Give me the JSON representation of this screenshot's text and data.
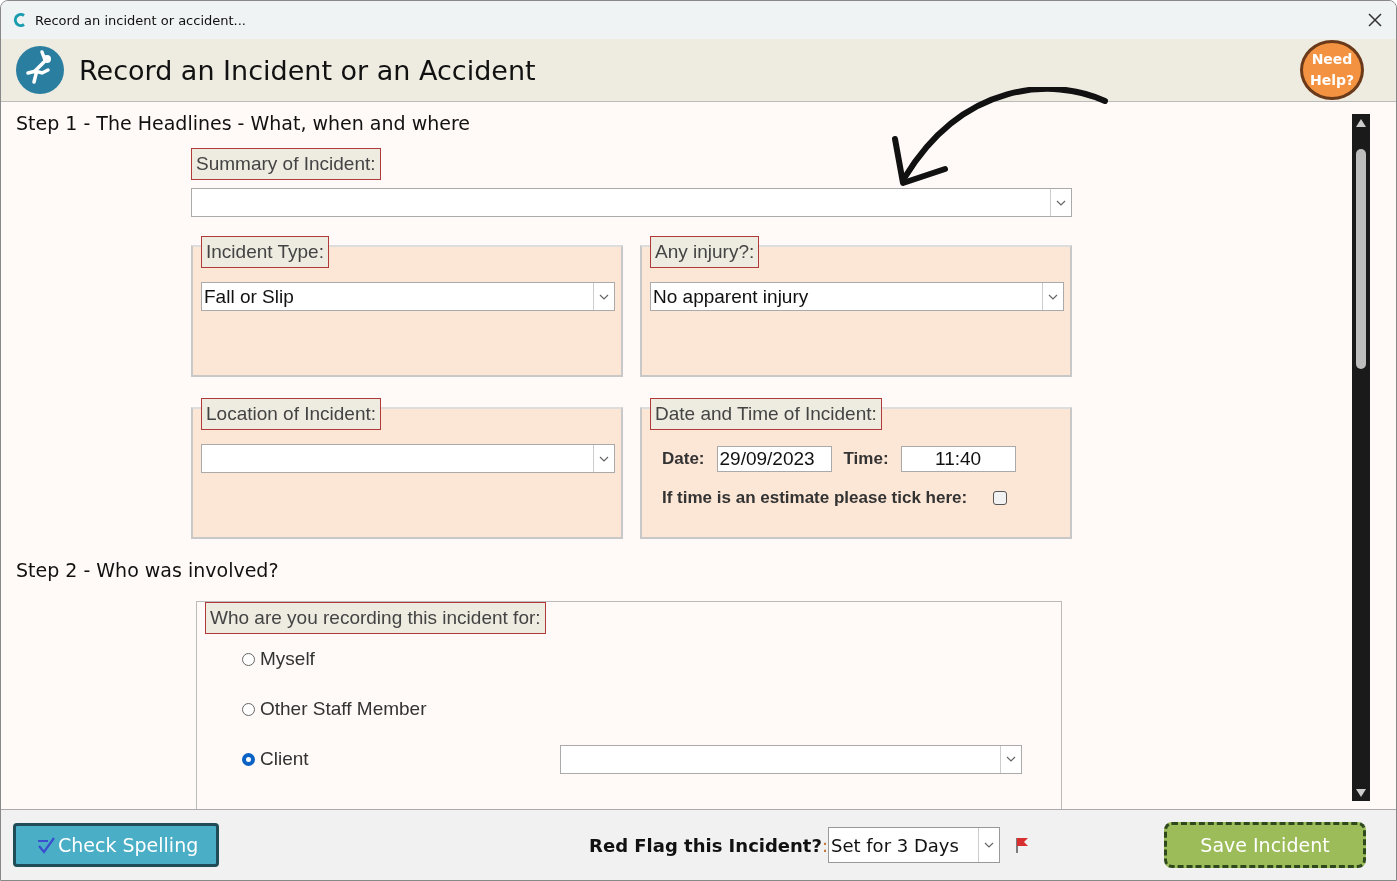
{
  "window": {
    "title": "Record an incident or accident..."
  },
  "header": {
    "title": "Record an Incident or an Accident",
    "help": "Need Help?"
  },
  "step1": {
    "heading": "Step 1 - The Headlines - What, when and where",
    "summary": {
      "label": "Summary of Incident:"
    },
    "incident_type": {
      "label": "Incident Type:",
      "value": "Fall or Slip"
    },
    "injury": {
      "label": "Any injury?:",
      "value": "No apparent injury"
    },
    "location": {
      "label": "Location of Incident:"
    },
    "datetime": {
      "label": "Date and Time of Incident:",
      "date_label": "Date:",
      "date": "29/09/2023",
      "time_label": "Time:",
      "time": "11:40",
      "estimate_label": "If time is an estimate please tick here:",
      "estimate_checked": false
    }
  },
  "step2": {
    "heading": "Step 2 - Who was involved?",
    "who": {
      "label": "Who are you recording this incident for:",
      "options": [
        {
          "label": "Myself",
          "selected": false
        },
        {
          "label": "Other Staff Member",
          "selected": false
        },
        {
          "label": "Client",
          "selected": true
        }
      ]
    }
  },
  "footer": {
    "spell_button": "Check Spelling",
    "red_flag_label": "Red Flag this Incident?",
    "red_flag_colon": ":",
    "red_flag_value": "Set for 3 Days",
    "save_button": "Save Incident"
  }
}
